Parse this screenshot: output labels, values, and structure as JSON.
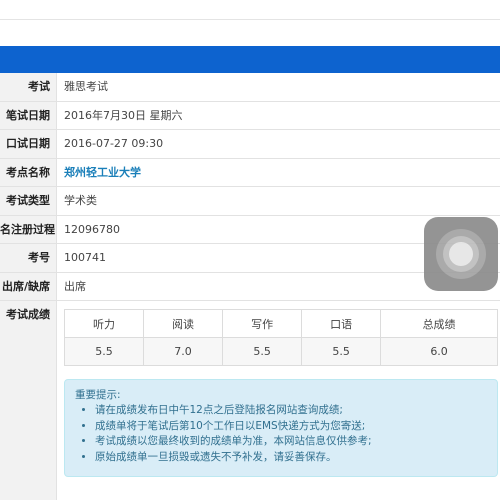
{
  "info_rows": [
    {
      "label": "考试",
      "value": "雅思考试"
    },
    {
      "label": "笔试日期",
      "value": "2016年7月30日 星期六"
    },
    {
      "label": "口试日期",
      "value": "2016-07-27 09:30"
    },
    {
      "label": "考点名称",
      "value": "郑州轻工业大学"
    },
    {
      "label": "考试类型",
      "value": "学术类"
    },
    {
      "label": "名注册过程)",
      "value": "12096780"
    },
    {
      "label": "考号",
      "value": "100741"
    },
    {
      "label": "出席/缺席",
      "value": "出席"
    }
  ],
  "scores": {
    "label": "考试成绩",
    "headers": [
      "听力",
      "阅读",
      "写作",
      "口语",
      "总成绩"
    ],
    "values": [
      "5.5",
      "7.0",
      "5.5",
      "5.5",
      "6.0"
    ]
  },
  "notice": {
    "title": "重要提示:",
    "items": [
      "请在成绩发布日中午12点之后登陆报名网站查询成绩;",
      "成绩单将于笔试后第10个工作日以EMS快递方式为您寄送;",
      "考试成绩以您最终收到的成绩单为准，本网站信息仅供参考;",
      "原始成绩单一旦损毁或遗失不予补发，请妥善保存。"
    ]
  },
  "colors": {
    "header_blue": "#0d63cf",
    "link": "#1a7fb9",
    "notice_bg": "#d9edf7",
    "notice_text": "#31708f"
  },
  "icons": {
    "assistive_touch": "assistive-touch-icon"
  }
}
